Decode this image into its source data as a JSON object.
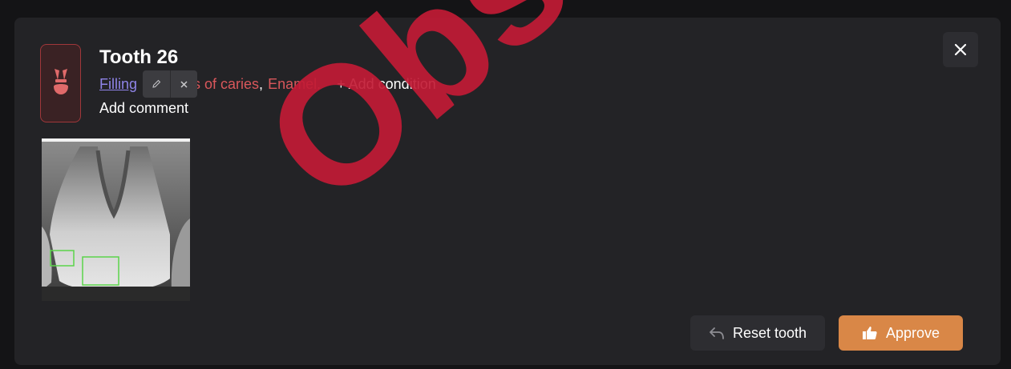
{
  "modal": {
    "title": "Tooth 26",
    "tooth_badge_icon": "tooth-icon",
    "close_icon": "close-icon"
  },
  "conditions": {
    "first_link": "Filling",
    "hidden_fragment": "s of caries",
    "separator": ",",
    "second": "Enamel",
    "second_sep": ".",
    "add_condition": "+ Add condition"
  },
  "edit_popover": {
    "edit_icon": "pencil-icon",
    "remove_icon": "close-icon"
  },
  "add_comment": "Add comment",
  "footer": {
    "reset_label": "Reset tooth",
    "reset_icon": "undo-icon",
    "approve_label": "Approve",
    "approve_icon": "thumbs-up-icon"
  },
  "watermark": {
    "text": "Obs"
  },
  "colors": {
    "modal_bg": "#232326",
    "accent_approve": "#d98747",
    "condition_link": "#8f84e8",
    "condition_red": "#d9575b",
    "detection_box": "#5bd44a",
    "watermark": "#c21b35"
  }
}
